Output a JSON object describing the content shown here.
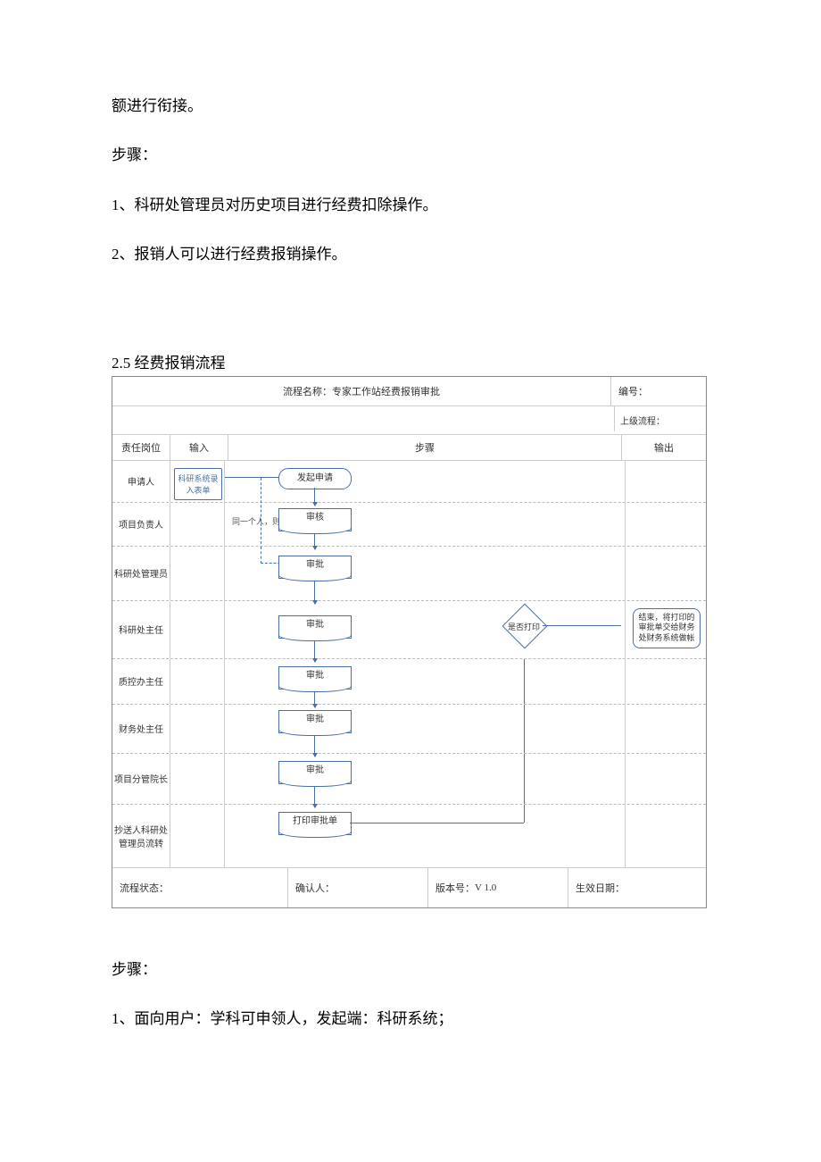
{
  "text": {
    "line_cont": "额进行衔接。",
    "steps_label": "步骤：",
    "step1": "1、科研处管理员对历史项目进行经费扣除操作。",
    "step2": "2、报销人可以进行经费报销操作。",
    "section_title": "2.5 经费报销流程",
    "steps_label2": "步骤：",
    "post_step1": "1、面向用户：学科可申领人，发起端：科研系统；"
  },
  "flowchart": {
    "title_prefix": "流程名称：",
    "title": "专家工作站经费报销审批",
    "number_label": "编号：",
    "parent_label": "上级流程：",
    "col_role": "责任岗位",
    "col_input": "输入",
    "col_steps": "步骤",
    "col_output": "输出",
    "lanes": [
      {
        "role": "申请人",
        "input": "科研系统录入表单",
        "step": "发起申请"
      },
      {
        "role": "项目负责人",
        "step": "审核",
        "note": "同一个人，则跳过"
      },
      {
        "role": "科研处管理员",
        "step": "审批"
      },
      {
        "role": "科研处主任",
        "step": "审批",
        "decision": "是否打印",
        "output": "结束，将打印的审批单交给财务处财务系统做帐"
      },
      {
        "role": "质控办主任",
        "step": "审批"
      },
      {
        "role": "财务处主任",
        "step": "审批"
      },
      {
        "role": "项目分管院长",
        "step": "审批"
      },
      {
        "role": "抄送人科研处管理员流转",
        "step": "打印审批单"
      }
    ],
    "footer": {
      "status_label": "流程状态：",
      "confirm_label": "确认人：",
      "version_label": "版本号：",
      "version_value": "V 1.0",
      "date_label": "生效日期："
    }
  }
}
